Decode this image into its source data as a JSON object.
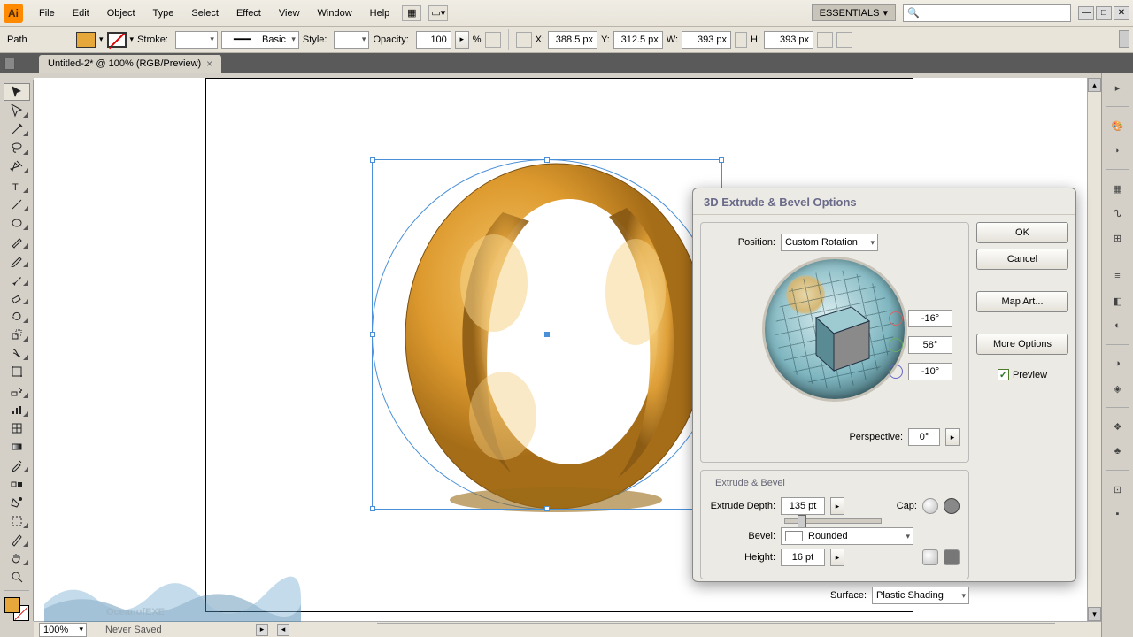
{
  "menu": {
    "items": [
      "File",
      "Edit",
      "Object",
      "Type",
      "Select",
      "Effect",
      "View",
      "Window",
      "Help"
    ]
  },
  "workspace": {
    "label": "ESSENTIALS"
  },
  "search": {
    "placeholder": ""
  },
  "controlbar": {
    "context": "Path",
    "stroke_label": "Stroke:",
    "stroke_weight": "",
    "brush": "Basic",
    "style_label": "Style:",
    "opacity_label": "Opacity:",
    "opacity": "100",
    "opacity_unit": "%",
    "x_label": "X:",
    "x": "388.5 px",
    "y_label": "Y:",
    "y": "312.5 px",
    "w_label": "W:",
    "w": "393 px",
    "h_label": "H:",
    "h": "393 px"
  },
  "document": {
    "tab": "Untitled-2* @ 100% (RGB/Preview)"
  },
  "dialog": {
    "title": "3D Extrude & Bevel Options",
    "position_label": "Position:",
    "position": "Custom Rotation",
    "rot_x": "-16°",
    "rot_y": "58°",
    "rot_z": "-10°",
    "perspective_label": "Perspective:",
    "perspective": "0°",
    "section": "Extrude & Bevel",
    "depth_label": "Extrude Depth:",
    "depth": "135 pt",
    "cap_label": "Cap:",
    "bevel_label": "Bevel:",
    "bevel": "Rounded",
    "height_label": "Height:",
    "height": "16 pt",
    "surface_label": "Surface:",
    "surface": "Plastic Shading",
    "ok": "OK",
    "cancel": "Cancel",
    "map_art": "Map Art...",
    "more": "More Options",
    "preview": "Preview"
  },
  "status": {
    "zoom": "100%",
    "save": "Never Saved"
  },
  "colors": {
    "fill": "#e6a83a",
    "accent": "#4a90d9"
  }
}
